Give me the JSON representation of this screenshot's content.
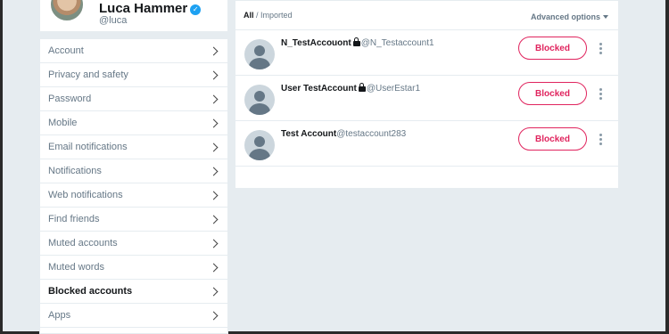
{
  "profile": {
    "name": "Luca Hammer",
    "handle": "@luca"
  },
  "settings_menu": {
    "items": [
      {
        "label": "Account"
      },
      {
        "label": "Privacy and safety"
      },
      {
        "label": "Password"
      },
      {
        "label": "Mobile"
      },
      {
        "label": "Email notifications"
      },
      {
        "label": "Notifications"
      },
      {
        "label": "Web notifications"
      },
      {
        "label": "Find friends"
      },
      {
        "label": "Muted accounts"
      },
      {
        "label": "Muted words"
      },
      {
        "label": "Blocked accounts",
        "active": true
      },
      {
        "label": "Apps"
      }
    ]
  },
  "main": {
    "tabs": {
      "all": "All",
      "separator": " / ",
      "imported": "Imported"
    },
    "advanced_options": "Advanced options",
    "blocked_accounts": [
      {
        "name": "N_TestAccouont",
        "protected": true,
        "handle": "@N_Testaccount1",
        "button": "Blocked"
      },
      {
        "name": "User TestAccount",
        "protected": true,
        "handle": "@UserEstar1",
        "button": "Blocked"
      },
      {
        "name": "Test Account",
        "protected": false,
        "handle": "@testaccount283",
        "button": "Blocked"
      }
    ]
  },
  "colors": {
    "blocked_accent": "#e0245e",
    "verified_blue": "#1da1f2",
    "background": "#e6ecf0"
  },
  "icons": {
    "verified": "verified-badge-icon",
    "chevron": "chevron-right-icon",
    "lock": "lock-icon",
    "more": "more-vertical-icon",
    "caret": "caret-down-icon"
  }
}
